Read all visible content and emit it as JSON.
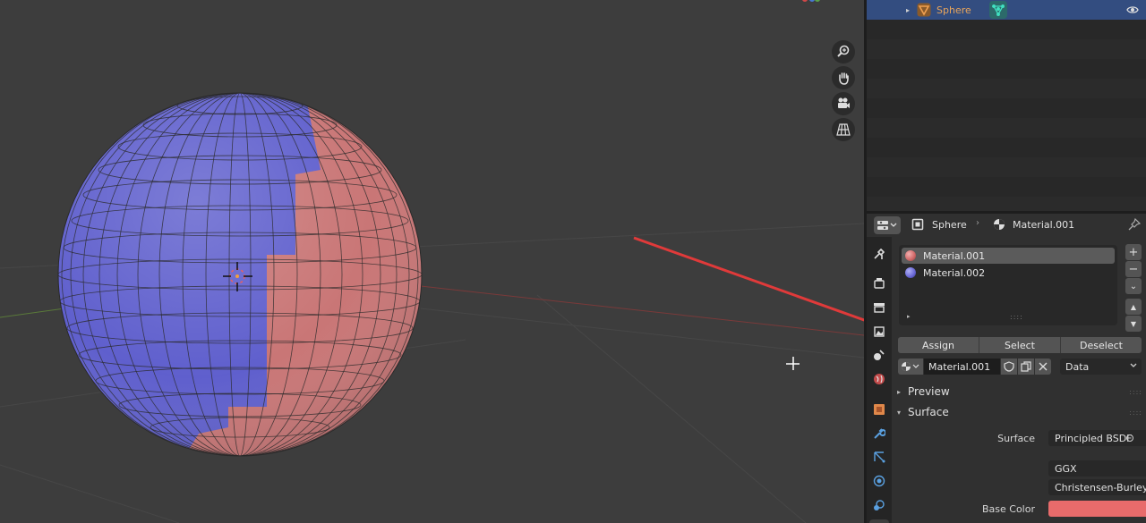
{
  "viewport": {
    "cursor_icon": "crosshair-cursor-icon",
    "nav_gizmos": [
      "zoom-icon",
      "hand-pan-icon",
      "camera-icon",
      "grid-perspective-icon"
    ]
  },
  "outliner": {
    "row": {
      "expand": "▸",
      "name": "Sphere"
    }
  },
  "properties": {
    "breadcrumb": {
      "object": "Sphere",
      "separator": "›",
      "material": "Material.001"
    },
    "slots": [
      {
        "label": "Material.001",
        "color": "#d36b6b"
      },
      {
        "label": "Material.002",
        "color": "#6d6bd8"
      }
    ],
    "slot_side_buttons": {
      "add": "+",
      "remove": "−",
      "specials": "⌄",
      "up": "▲",
      "down": "▼"
    },
    "list_expand": "▸",
    "list_grip": "::::",
    "assign_buttons": {
      "assign": "Assign",
      "select": "Select",
      "deselect": "Deselect"
    },
    "material_name": "Material.001",
    "link_dropdown": "Data",
    "panels": {
      "preview": {
        "label": "Preview",
        "tri": "▸"
      },
      "surface": {
        "label": "Surface",
        "tri": "▾"
      }
    },
    "panel_grip": "::::",
    "surface_field": {
      "label": "Surface",
      "value": "Principled BSDF"
    },
    "distribution": "GGX",
    "subsurface_method": "Christensen-Burley",
    "base_color": {
      "label": "Base Color",
      "value": "#e86b6b"
    }
  },
  "annotation": {
    "arrow_color": "#e03a3a"
  },
  "colors": {
    "viewport_bg": "#3d3d3d",
    "selection_row": "#334d80",
    "sphere_blue": "#5c5ccc",
    "sphere_red": "#c87373"
  }
}
